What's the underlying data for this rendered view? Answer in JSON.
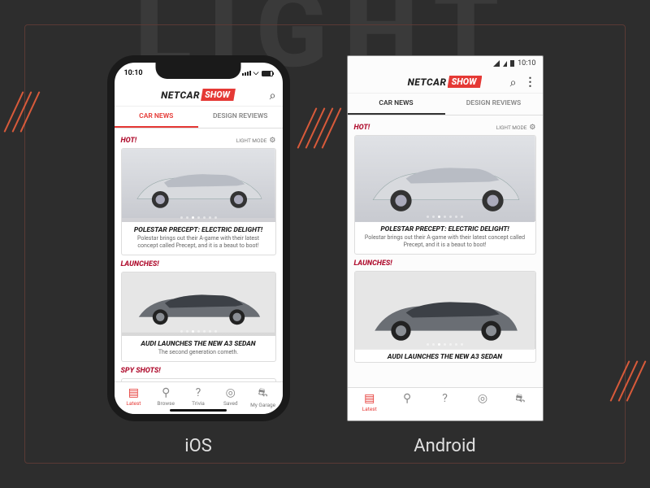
{
  "bg_text": "LIGHT",
  "labels": {
    "ios": "iOS",
    "android": "Android"
  },
  "statusbar": {
    "ios_time": "10:10",
    "android_time": "10:10"
  },
  "logo": {
    "net": "NETCAR",
    "show": "SHOW"
  },
  "tabs": {
    "news": "CAR NEWS",
    "reviews": "DESIGN REVIEWS"
  },
  "sections": {
    "hot": "HOT!",
    "launches": "LAUNCHES!",
    "spy": "SPY SHOTS!",
    "lightmode": "LIGHT MODE"
  },
  "cards": {
    "polestar": {
      "title": "POLESTAR PRECEPT: ELECTRIC DELIGHT!",
      "desc": "Polestar brings out their A-game with their latest concept called Precept, and it is a beaut to boot!"
    },
    "audi": {
      "title": "AUDI LAUNCHES THE NEW A3 SEDAN",
      "desc": "The second generation cometh."
    }
  },
  "bottomnav": {
    "latest": "Latest",
    "browse": "Browse",
    "trivia": "Trivia",
    "saved": "Saved",
    "garage": "My Garage"
  }
}
